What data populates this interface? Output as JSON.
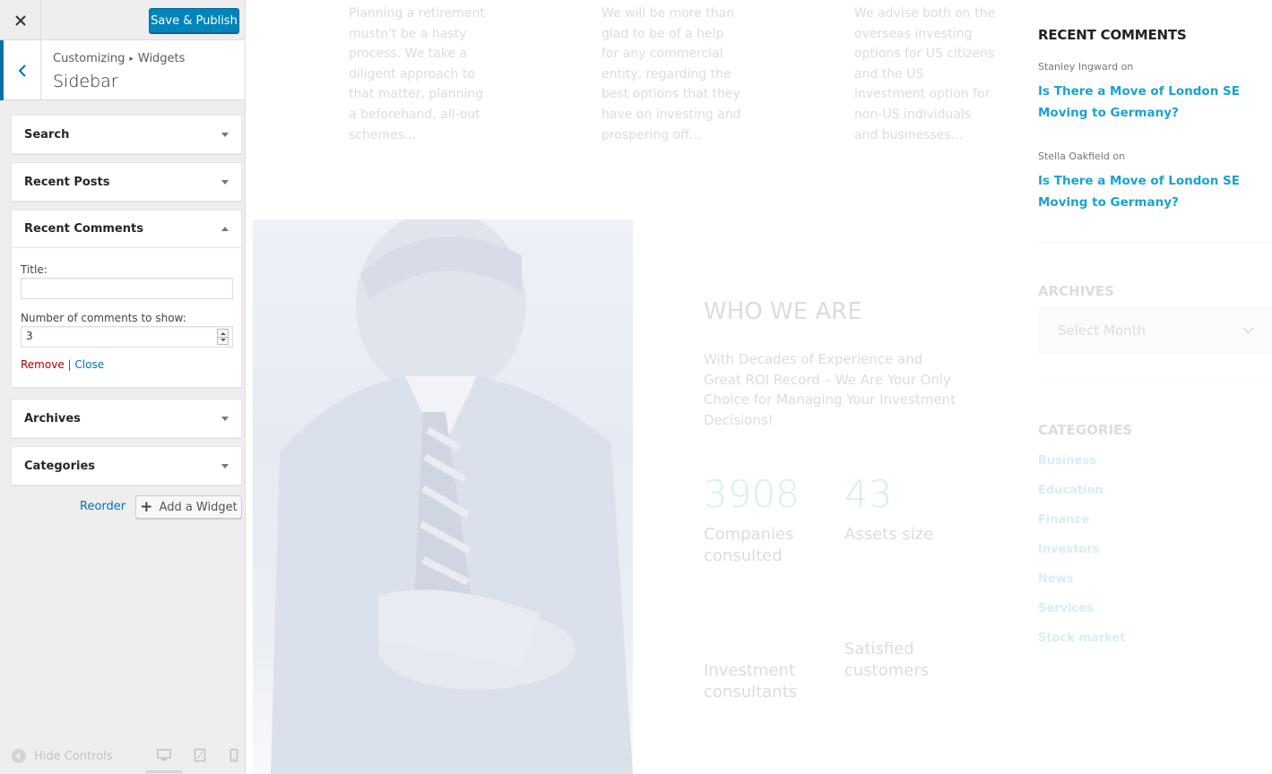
{
  "customizer": {
    "close_icon": "close-icon",
    "save_label": "Save & Publish",
    "breadcrumb": {
      "root": "Customizing",
      "separator": "▸",
      "current": "Widgets"
    },
    "section_title": "Sidebar",
    "widgets": [
      {
        "title": "Search",
        "expanded": false
      },
      {
        "title": "Recent Posts",
        "expanded": false
      },
      {
        "title": "Recent Comments",
        "expanded": true
      },
      {
        "title": "Archives",
        "expanded": false
      },
      {
        "title": "Categories",
        "expanded": false
      }
    ],
    "recent_comments_form": {
      "title_label": "Title:",
      "title_value": "",
      "count_label": "Number of comments to show:",
      "count_value": "3",
      "remove_label": "Remove",
      "separator": "|",
      "close_label": "Close"
    },
    "reorder_label": "Reorder",
    "add_widget_label": "Add a Widget",
    "hide_controls_label": "Hide Controls",
    "accent_color": "#0085ba"
  },
  "preview": {
    "services": [
      "Planning a retirement mustn't be a hasty process. We take a diligent approach to that matter, planning a beforehand, all-out schemes...",
      "We will be more than glad to be of a help for any commercial entity, regarding the best options that they have on investing and prospering off...",
      "We advise both on the overseas investing options for US citizens and the US investment option for non-US individuals and businesses..."
    ],
    "who_title": "WHO WE ARE",
    "who_subtitle": "With Decades of Experience and Great ROI Record – We Are Your Only Choice for Managing Your Investment Decisions!",
    "stats": [
      {
        "number": "3908",
        "label": "Companies consulted"
      },
      {
        "number": "43",
        "label": "Assets size"
      },
      {
        "number": "",
        "label": "Investment consultants"
      },
      {
        "number": "",
        "label": "Satisfied customers"
      }
    ],
    "sidebar": {
      "recent_comments_heading": "RECENT COMMENTS",
      "comments": [
        {
          "author": "Stanley Ingward on",
          "post": "Is There a Move of London SE Moving to Germany?"
        },
        {
          "author": "Stella Oakfield on",
          "post": "Is There a Move of London SE Moving to Germany?"
        }
      ],
      "archives_heading": "ARCHIVES",
      "archives_select": "Select Month",
      "categories_heading": "CATEGORIES",
      "categories": [
        "Business",
        "Education",
        "Finance",
        "Investors",
        "News",
        "Services",
        "Stock market"
      ]
    },
    "link_color": "#1aa2cf"
  }
}
